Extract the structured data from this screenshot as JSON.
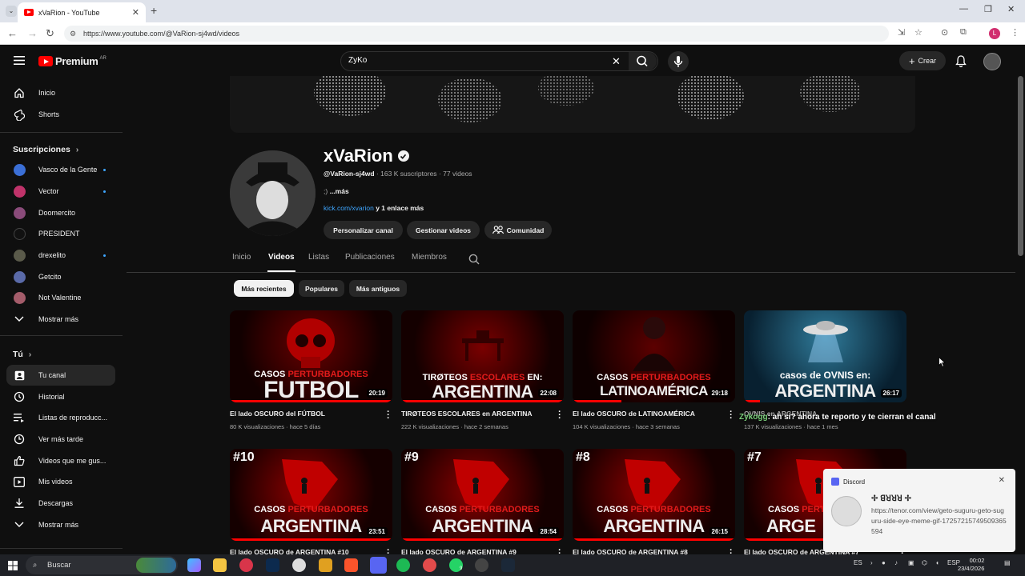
{
  "browser": {
    "tab_title": "xVaRion - YouTube",
    "tab_close": "✕",
    "new_tab": "+",
    "url": "https://www.youtube.com/@VaRion-sj4wd/videos",
    "profile_letter": "L"
  },
  "header": {
    "logo_text": "Premium",
    "region": "AR",
    "search_value": "ZyKo",
    "create_label": "Crear"
  },
  "sidebar": {
    "main": [
      {
        "label": "Inicio",
        "icon": "home-icon"
      },
      {
        "label": "Shorts",
        "icon": "shorts-icon"
      }
    ],
    "subs_heading": "Suscripciones",
    "subs": [
      {
        "label": "Vasco de la Gente",
        "color": "#3b6fd6",
        "new": true
      },
      {
        "label": "Vector",
        "color": "#c0336a",
        "new": true
      },
      {
        "label": "Doomercito",
        "color": "#8a4b7a",
        "new": false
      },
      {
        "label": "PRESIDENT",
        "color": "#111111",
        "new": false
      },
      {
        "label": "drexelito",
        "color": "#5a5a4a",
        "new": true
      },
      {
        "label": "Getcito",
        "color": "#5a6aa8",
        "new": false
      },
      {
        "label": "Not Valentine",
        "color": "#a45c6a",
        "new": false
      }
    ],
    "subs_more": "Mostrar más",
    "you_heading": "Tú",
    "you": [
      {
        "label": "Tu canal",
        "icon": "channel-icon"
      },
      {
        "label": "Historial",
        "icon": "history-icon"
      },
      {
        "label": "Listas de reproducc...",
        "icon": "playlists-icon"
      },
      {
        "label": "Ver más tarde",
        "icon": "watch-later-icon"
      },
      {
        "label": "Videos que me gus...",
        "icon": "like-icon"
      },
      {
        "label": "Mis videos",
        "icon": "my-videos-icon"
      },
      {
        "label": "Descargas",
        "icon": "downloads-icon"
      },
      {
        "label": "Mostrar más",
        "icon": "chevron-down-icon"
      }
    ]
  },
  "channel": {
    "name": "xVaRion",
    "handle": "@VaRion-sj4wd",
    "subscribers": "163 K suscriptores",
    "video_count": "77 videos",
    "separator": "·",
    "description": ";)",
    "more": "...más",
    "link": "kick.com/xvarion",
    "link_more": "y 1 enlace más",
    "buttons": [
      "Personalizar canal",
      "Gestionar videos",
      "Comunidad"
    ],
    "tabs": [
      "Inicio",
      "Videos",
      "Listas",
      "Publicaciones",
      "Miembros"
    ],
    "chips": [
      "Más recientes",
      "Populares",
      "Más antiguos"
    ]
  },
  "videos": [
    {
      "title": "El lado OSCURO del FÚTBOL",
      "views": "80 K visualizaciones",
      "age": "hace 5 días",
      "duration": "20:19",
      "thumb_small_1": "CASOS ",
      "thumb_small_2": "PERTURBADORES",
      "thumb_big": "FUTBOL",
      "progress": 1.0
    },
    {
      "title": "TIRØTEOS ESCOLARES en ARGENTINA",
      "views": "222 K visualizaciones",
      "age": "hace 2 semanas",
      "duration": "22:08",
      "thumb_small_1": "TIRØTEOS ",
      "thumb_small_2": "ESCOLARES",
      "thumb_small_3": " EN:",
      "thumb_big": "ARGENTINA",
      "progress": 1.0
    },
    {
      "title": "El lado OSCURO de LATINOAMÉRICA",
      "views": "104 K visualizaciones",
      "age": "hace 3 semanas",
      "duration": "29:18",
      "thumb_small_1": "CASOS ",
      "thumb_small_2": "PERTURBADORES",
      "thumb_big": "LATINOAMÉRICA",
      "progress": 0.3
    },
    {
      "title": "OVNIS en ARGENTINA",
      "views": "137 K visualizaciones",
      "age": "hace 1 mes",
      "duration": "26:17",
      "thumb_small_1": "casos de OVNIS en:",
      "thumb_big": "ARGENTINA",
      "progress": 0.1
    },
    {
      "title": "El lado OSCURO de ARGENTINA #10",
      "duration": "23:51",
      "number": "#10",
      "thumb_small_1": "CASOS ",
      "thumb_small_2": "PERTURBADORES",
      "thumb_big": "ARGENTINA",
      "progress": 1.0
    },
    {
      "title": "El lado OSCURO de ARGENTINA #9",
      "duration": "28:54",
      "number": "#9",
      "thumb_small_1": "CASOS ",
      "thumb_small_2": "PERTURBADORES",
      "thumb_big": "ARGENTINA",
      "progress": 1.0
    },
    {
      "title": "El lado OSCURO de ARGENTINA #8",
      "duration": "26:15",
      "number": "#8",
      "thumb_small_1": "CASOS ",
      "thumb_small_2": "PERTURBADORES",
      "thumb_big": "ARGENTINA",
      "progress": 1.0
    },
    {
      "title": "El lado OSCURO de ARGENTINA #7",
      "number": "#7",
      "thumb_small_1": "CASOS ",
      "thumb_small_2": "PERTURBADORES",
      "thumb_big": "ARGE",
      "progress": 1.0
    }
  ],
  "overlay": {
    "chat_user": "Zykogg",
    "chat_message": ": ah si? ahora te reporto y te cierran el canal"
  },
  "discord": {
    "app": "Discord",
    "close": "✕",
    "sender": "✢ ꓭꓤꓤꓤ ✢",
    "message": "https://tenor.com/view/geto-suguru-geto-suguru-side-eye-meme-gif-17257215749509365594"
  },
  "taskbar": {
    "search": "Buscar",
    "lang1": "ES",
    "lang2": "ESP",
    "time": "00:02",
    "date": "23/4/2026",
    "badge": "9"
  },
  "colors": {
    "accent": "#ff0000",
    "link": "#3ea6ff",
    "bg": "#0f0f0f"
  }
}
